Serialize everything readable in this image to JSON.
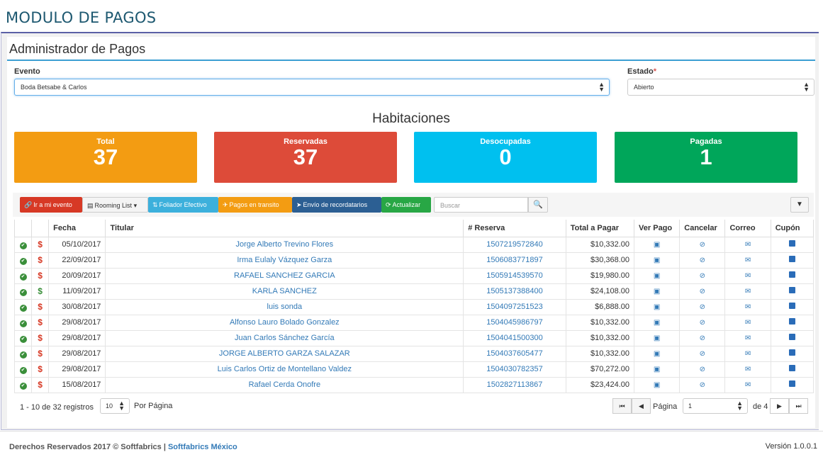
{
  "module_title": "MODULO DE PAGOS",
  "panel_title": "Administrador de Pagos",
  "filters": {
    "evento_label": "Evento",
    "evento_value": "Boda Betsabe & Carlos",
    "estado_label": "Estado",
    "estado_required": "*",
    "estado_value": "Abierto"
  },
  "habitaciones": {
    "title": "Habitaciones",
    "cards": [
      {
        "label": "Total",
        "value": "37",
        "color": "#f39c12"
      },
      {
        "label": "Reservadas",
        "value": "37",
        "color": "#dd4b39"
      },
      {
        "label": "Desocupadas",
        "value": "0",
        "color": "#00c0ef"
      },
      {
        "label": "Pagadas",
        "value": "1",
        "color": "#00a65a"
      }
    ]
  },
  "toolbar": {
    "ir_evento": "Ir a mi evento",
    "rooming_list": "Rooming List",
    "foliador": "Foliador Efectivo",
    "pagos_transito": "Pagos en transito",
    "envio_recordatorios": "Envío de recordatarios",
    "actualizar": "Actualizar",
    "search_placeholder": "Buscar"
  },
  "table": {
    "headers": [
      "Fecha",
      "Titular",
      "# Reserva",
      "Total a Pagar",
      "Ver Pago",
      "Cancelar",
      "Correo",
      "Cupón"
    ],
    "rows": [
      {
        "paid": false,
        "fecha": "05/10/2017",
        "titular": "Jorge Alberto Trevino Flores",
        "reserva": "1507219572840",
        "total": "$10,332.00"
      },
      {
        "paid": false,
        "fecha": "22/09/2017",
        "titular": "Irma Eulaly Vázquez Garza",
        "reserva": "1506083771897",
        "total": "$30,368.00"
      },
      {
        "paid": false,
        "fecha": "20/09/2017",
        "titular": "RAFAEL SANCHEZ GARCIA",
        "reserva": "1505914539570",
        "total": "$19,980.00"
      },
      {
        "paid": true,
        "fecha": "11/09/2017",
        "titular": "KARLA SANCHEZ",
        "reserva": "1505137388400",
        "total": "$24,108.00"
      },
      {
        "paid": false,
        "fecha": "30/08/2017",
        "titular": "luis sonda",
        "reserva": "1504097251523",
        "total": "$6,888.00"
      },
      {
        "paid": false,
        "fecha": "29/08/2017",
        "titular": "Alfonso Lauro Bolado Gonzalez",
        "reserva": "1504045986797",
        "total": "$10,332.00"
      },
      {
        "paid": false,
        "fecha": "29/08/2017",
        "titular": "Juan Carlos Sánchez García",
        "reserva": "1504041500300",
        "total": "$10,332.00"
      },
      {
        "paid": false,
        "fecha": "29/08/2017",
        "titular": "JORGE ALBERTO GARZA SALAZAR",
        "reserva": "1504037605477",
        "total": "$10,332.00"
      },
      {
        "paid": false,
        "fecha": "29/08/2017",
        "titular": "Luis Carlos Ortiz de Montellano Valdez",
        "reserva": "1504030782357",
        "total": "$70,272.00"
      },
      {
        "paid": false,
        "fecha": "15/08/2017",
        "titular": "Rafael Cerda Onofre",
        "reserva": "1502827113867",
        "total": "$23,424.00"
      }
    ]
  },
  "pagination": {
    "summary": "1 - 10 de 32 registros",
    "per_page_value": "10",
    "per_page_label": "Por Página",
    "page_label": "Página",
    "page_value": "1",
    "of_label": "de 4"
  },
  "footer": {
    "rights": "Derechos Reservados 2017 © Softfabrics |",
    "brand": "Softfabrics México",
    "version": "Versión 1.0.0.1"
  }
}
